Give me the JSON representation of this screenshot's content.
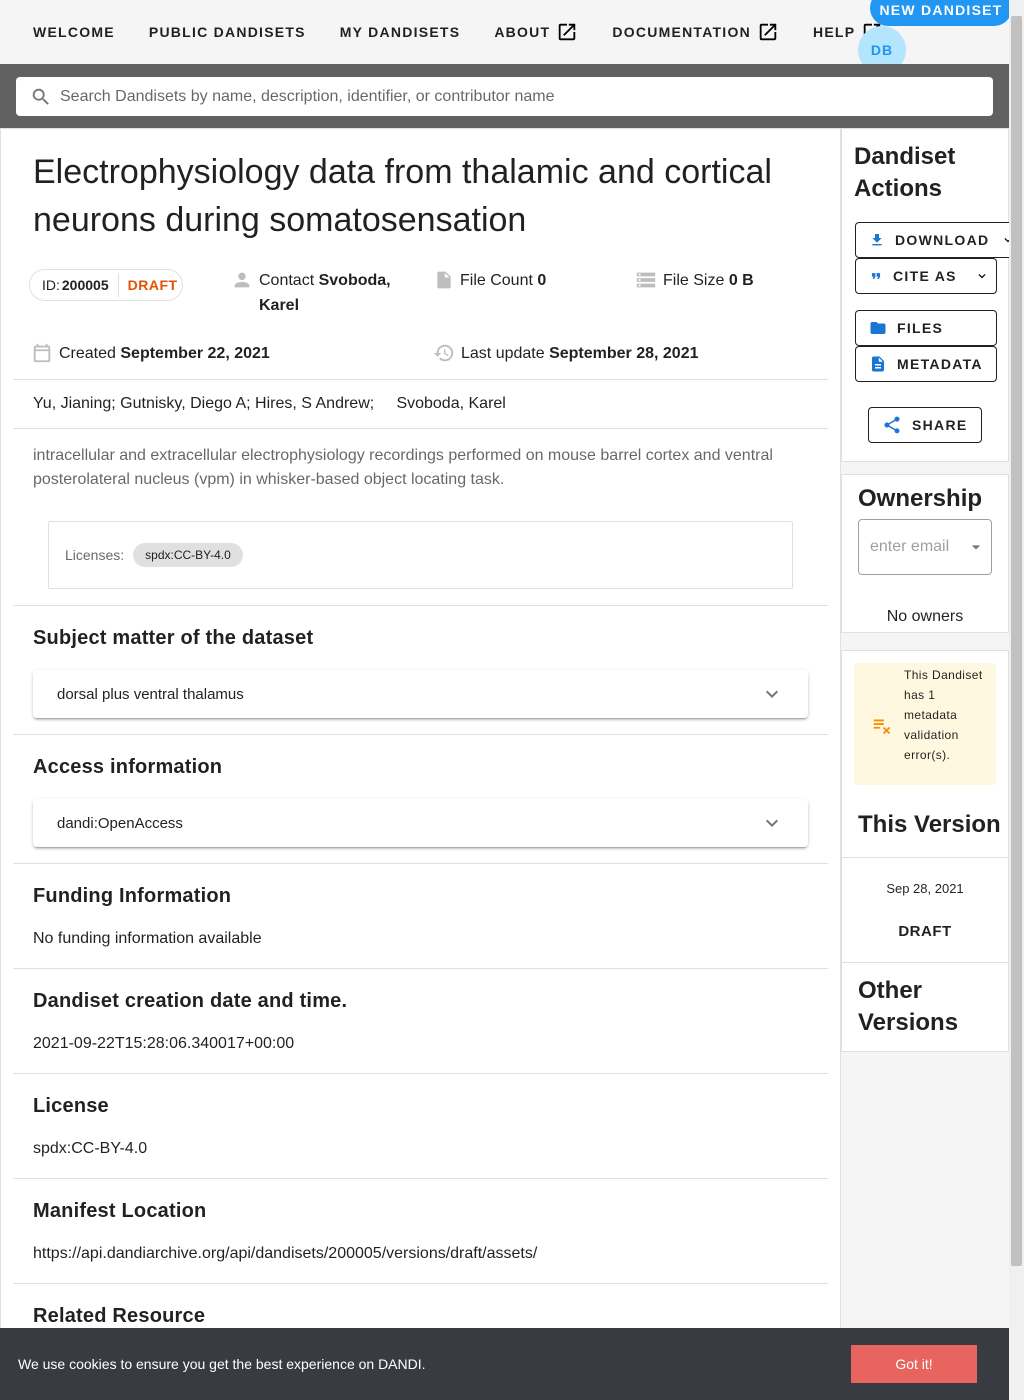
{
  "nav": {
    "items": [
      {
        "label": "WELCOME",
        "external": false
      },
      {
        "label": "PUBLIC DANDISETS",
        "external": false
      },
      {
        "label": "MY DANDISETS",
        "external": false
      },
      {
        "label": "ABOUT",
        "external": true
      },
      {
        "label": "DOCUMENTATION",
        "external": true
      },
      {
        "label": "HELP",
        "external": true
      }
    ],
    "new_dandiset_label": "NEW DANDISET",
    "avatar_initials": "DB"
  },
  "search": {
    "placeholder": "Search Dandisets by name, description, identifier, or contributor name"
  },
  "dandiset": {
    "title": "Electrophysiology data from thalamic and cortical neurons during somatosensation",
    "id_label": "ID:",
    "id": "200005",
    "status": "DRAFT",
    "contact_label": "Contact",
    "contact_name": "Svoboda, Karel",
    "file_count_label": "File Count",
    "file_count": "0",
    "file_size_label": "File Size",
    "file_size": "0 B",
    "created_label": "Created",
    "created": "September 22, 2021",
    "updated_label": "Last update",
    "updated": "September 28, 2021",
    "contributors": "Yu, Jianing; Gutnisky, Diego A; Hires, S Andrew;",
    "contributors_extra": "Svoboda, Karel",
    "description": "intracellular and extracellular electrophysiology recordings performed on mouse barrel cortex and ventral posterolateral nucleus (vpm) in whisker-based object locating task.",
    "licenses_label": "Licenses:",
    "license_chip": "spdx:CC-BY-4.0"
  },
  "sections": {
    "subject_heading": "Subject matter of the dataset",
    "subject_value": "dorsal plus ventral thalamus",
    "access_heading": "Access information",
    "access_value": "dandi:OpenAccess",
    "funding_heading": "Funding Information",
    "funding_value": "No funding information available",
    "creation_heading": "Dandiset creation date and time.",
    "creation_value": "2021-09-22T15:28:06.340017+00:00",
    "license_heading": "License",
    "license_value": "spdx:CC-BY-4.0",
    "manifest_heading": "Manifest Location",
    "manifest_value": "https://api.dandiarchive.org/api/dandisets/200005/versions/draft/assets/",
    "related_heading": "Related Resource"
  },
  "sidebar": {
    "actions_heading": "Dandiset Actions",
    "download_label": "DOWNLOAD",
    "cite_label": "CITE AS",
    "files_label": "FILES",
    "metadata_label": "METADATA",
    "share_label": "SHARE",
    "ownership_heading": "Ownership",
    "owner_placeholder": "enter email",
    "no_owners": "No owners",
    "validation_message": "This Dandiset has 1 metadata validation error(s).",
    "this_version_heading": "This Version",
    "version_date": "Sep 28, 2021",
    "version_status": "DRAFT",
    "other_versions_heading": "Other Versions"
  },
  "cookie": {
    "message": "We use cookies to ensure you get the best experience on DANDI.",
    "button_label": "Got it!"
  },
  "colors": {
    "primary": "#2196f3",
    "draft": "#e65100",
    "search_band": "#616161",
    "warning_bg": "#fff8e1",
    "warning_icon": "#fb8c00",
    "cookie_bg": "#383b41",
    "cookie_button": "#e8645f"
  }
}
